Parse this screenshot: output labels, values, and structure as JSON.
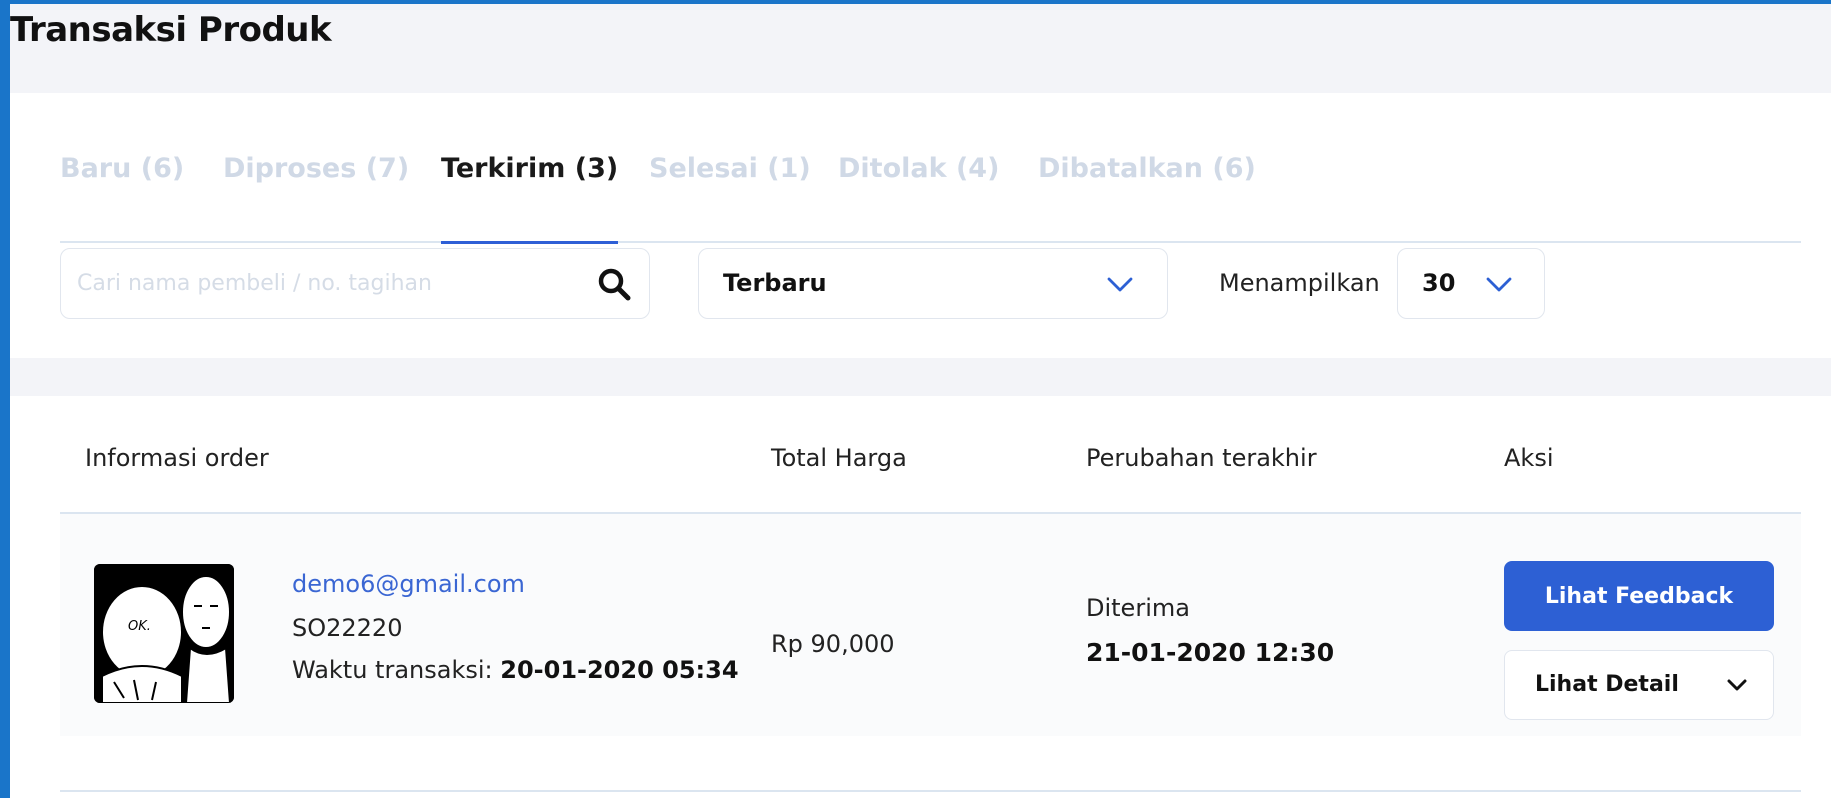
{
  "page": {
    "title": "Transaksi Produk"
  },
  "tabs": [
    {
      "label": "Baru (6)",
      "active": false
    },
    {
      "label": "Diproses (7)",
      "active": false
    },
    {
      "label": "Terkirim (3)",
      "active": true
    },
    {
      "label": "Selesai (1)",
      "active": false
    },
    {
      "label": "Ditolak (4)",
      "active": false
    },
    {
      "label": "Dibatalkan (6)",
      "active": false
    }
  ],
  "filters": {
    "search_placeholder": "Cari nama pembeli / no. tagihan",
    "search_value": "",
    "sort_value": "Terbaru",
    "show_label": "Menampilkan",
    "show_value": "30"
  },
  "table": {
    "columns": [
      "Informasi order",
      "Total Harga",
      "Perubahan terakhir",
      "Aksi"
    ],
    "rows": [
      {
        "email": "demo6@gmail.com",
        "order_no": "SO22220",
        "time_label": "Waktu transaksi:",
        "time_value": "20-01-2020 05:34",
        "total": "Rp 90,000",
        "status": "Diterima",
        "status_date": "21-01-2020 12:30",
        "avatar_text": "OK.",
        "feedback_button": "Lihat Feedback",
        "detail_button": "Lihat Detail"
      }
    ]
  },
  "colors": {
    "accent": "#2d60d4",
    "link": "#3a66d3",
    "frame": "#1a75c9",
    "tab_inactive": "#d0d9e6"
  },
  "icons": {
    "search": "search-icon",
    "chevron": "chevron-down-icon"
  }
}
